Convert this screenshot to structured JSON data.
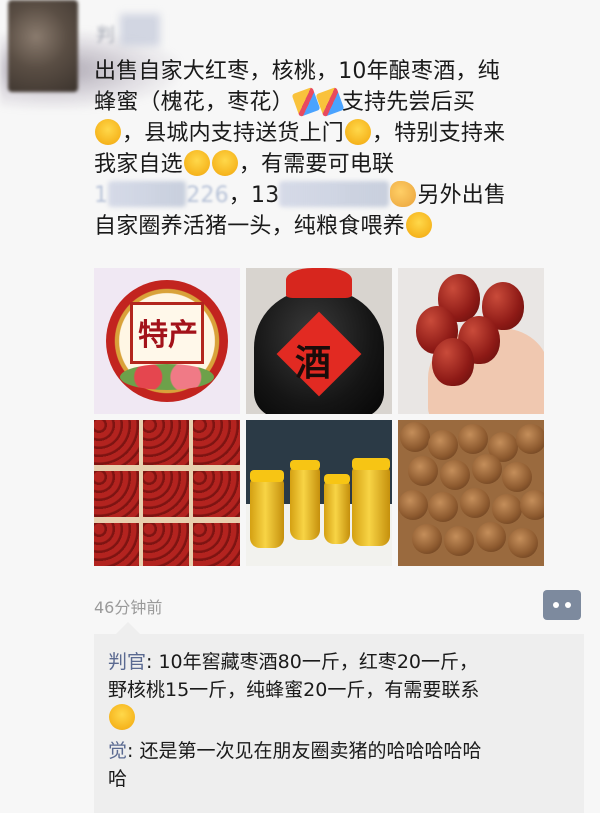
{
  "post": {
    "author": "判",
    "lines": [
      "出售自家大红枣，核桃，10年酿枣酒，纯",
      "蜂蜜（槐花，枣花）",
      "支持先尝后买",
      "，县城内支持送货上门",
      "，特别支持来",
      "我家自选",
      "，有需要可电联",
      "1",
      "226",
      "，13",
      "另外出售",
      "自家圈养活猪一头，纯粮食喂养"
    ],
    "time": "46分钟前",
    "images": [
      {
        "logo_text": "特产"
      },
      {
        "label": "酒"
      },
      {
        "label": ""
      },
      {
        "label": ""
      },
      {
        "label": ""
      },
      {
        "label": ""
      }
    ]
  },
  "comments": [
    {
      "name": "判官",
      "sep": ": ",
      "text": "10年窖藏枣酒80一斤，红枣20一斤，",
      "text2": "野核桃15一斤，纯蜂蜜20一斤，有需要联系"
    },
    {
      "name": "觉",
      "sep": ": ",
      "text": "还是第一次见在朋友圈卖猪的哈哈哈哈哈",
      "text2": "哈"
    }
  ],
  "icons": {
    "comment_button": "comment-dots-icon"
  }
}
